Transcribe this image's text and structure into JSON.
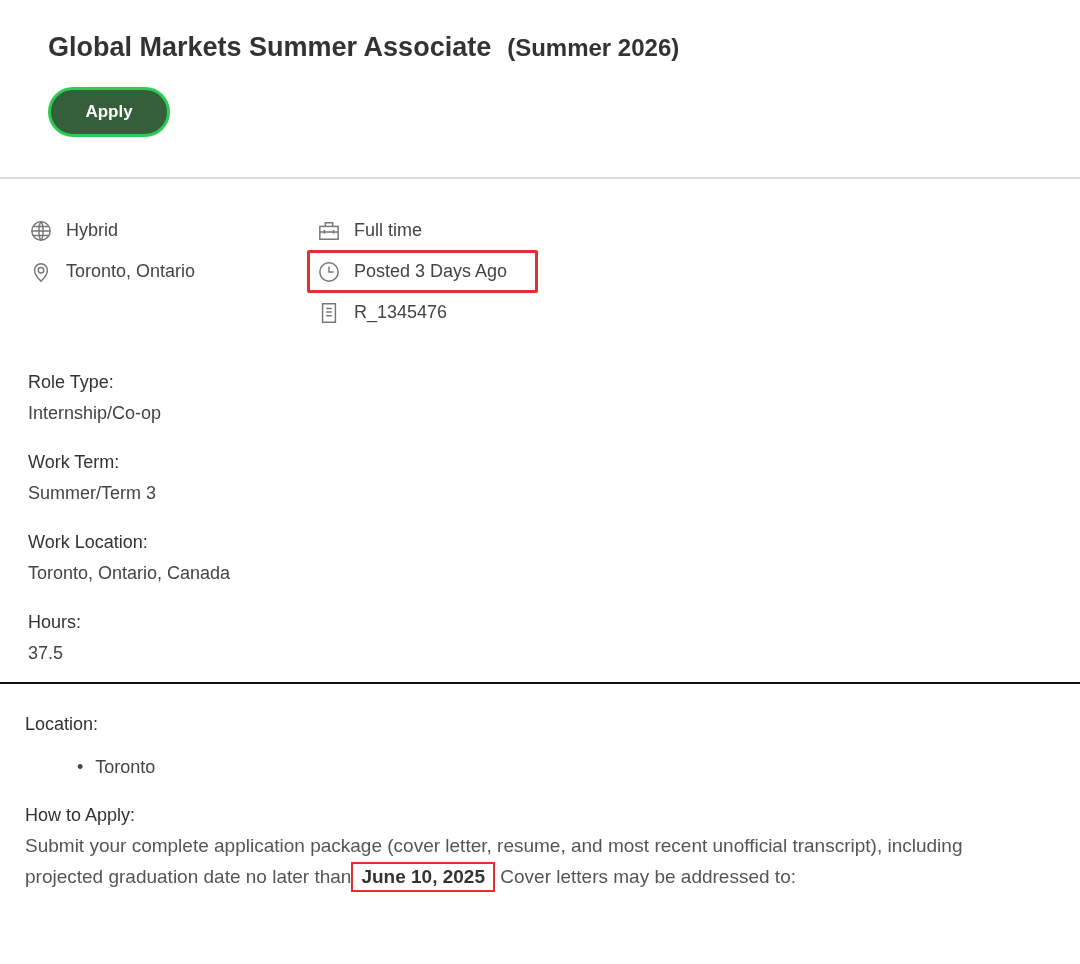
{
  "header": {
    "title": "Global Markets Summer Associate",
    "subtitle": "(Summer 2026)",
    "apply_button": "Apply"
  },
  "meta_columns": [
    [
      {
        "kind": "workplace",
        "text": "Hybrid",
        "highlighted": false
      },
      {
        "kind": "location",
        "text": "Toronto, Ontario",
        "highlighted": false
      }
    ],
    [
      {
        "kind": "schedule",
        "text": "Full time",
        "highlighted": false
      },
      {
        "kind": "posted",
        "text": "Posted 3 Days Ago",
        "highlighted": true
      },
      {
        "kind": "requisition",
        "text": "R_1345476",
        "highlighted": false
      }
    ]
  ],
  "fields": [
    {
      "label": "Role Type:",
      "value": "Internship/Co-op"
    },
    {
      "label": "Work Term:",
      "value": "Summer/Term 3"
    },
    {
      "label": "Work Location:",
      "value": "Toronto, Ontario, Canada"
    },
    {
      "label": "Hours:",
      "value": "37.5"
    }
  ],
  "location": {
    "label": "Location:",
    "items": [
      {
        "marker": "•",
        "text": "Toronto"
      }
    ]
  },
  "how_to_apply": {
    "label": "How to Apply:",
    "before": "Submit your complete application package (cover letter, resume, and most recent unofficial transcript), including projected graduation date no later than",
    "highlight": "June 10, 2025",
    "after": "Cover letters may be addressed to:"
  }
}
